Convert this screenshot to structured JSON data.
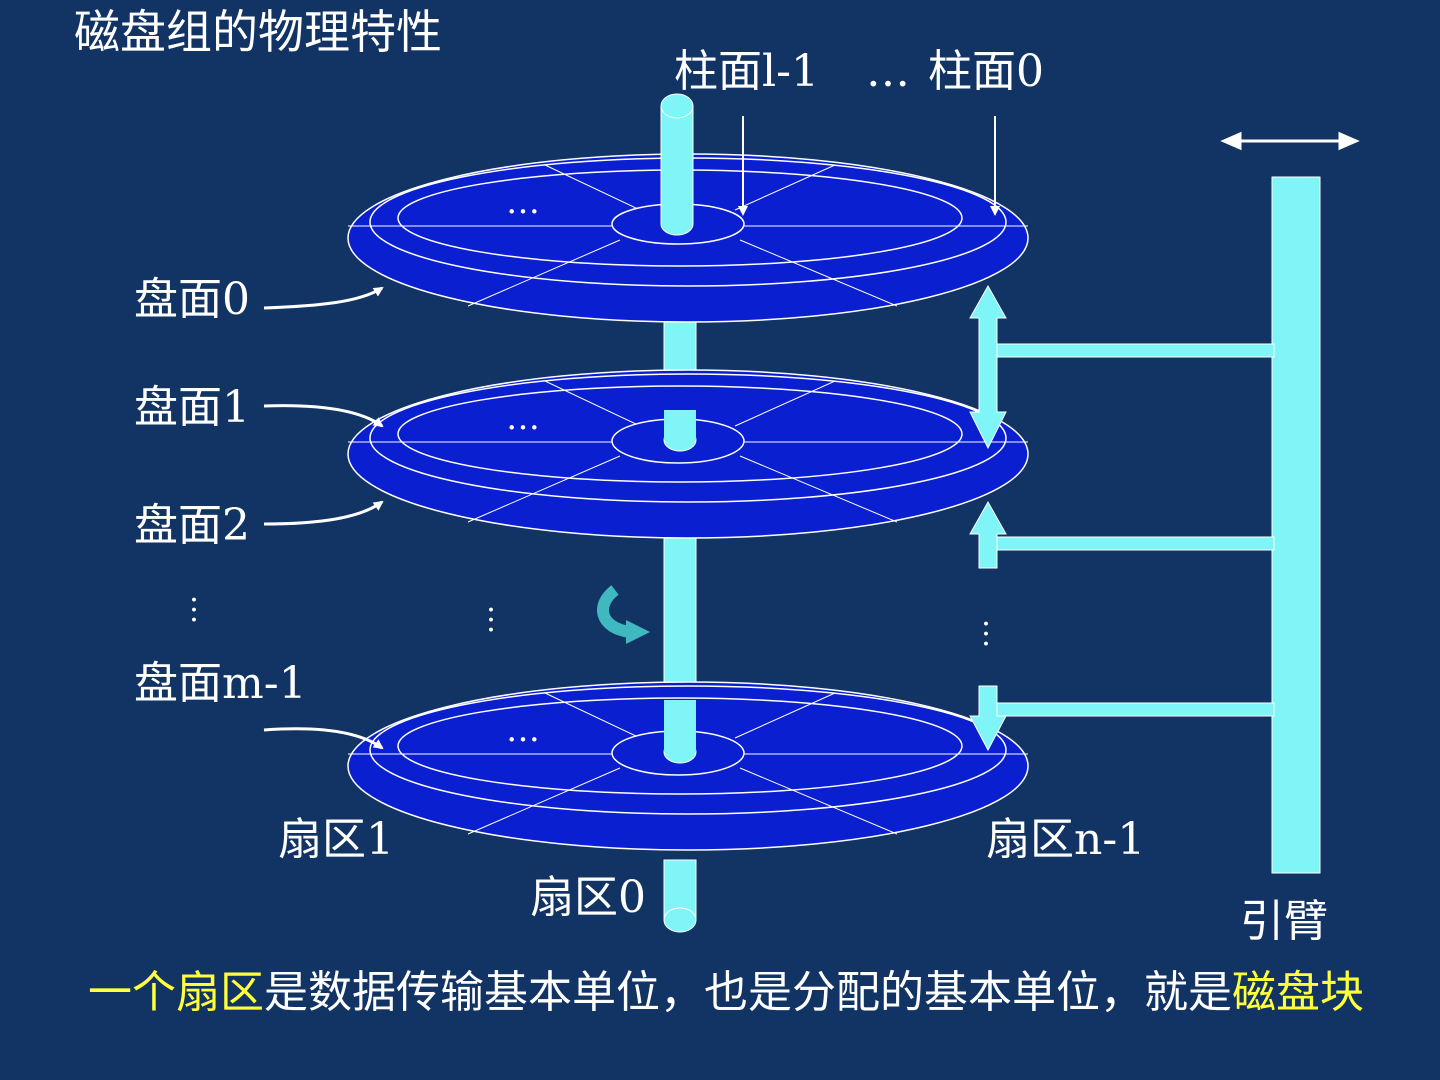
{
  "title": "磁盘组的物理特性",
  "labels": {
    "cylinder_l1": "柱面l-1",
    "ellipsis": "…",
    "cylinder_0": "柱面0",
    "surface_0": "盘面0",
    "surface_1": "盘面1",
    "surface_2": "盘面2",
    "surface_m1": "盘面m-1",
    "sector_1": "扇区1",
    "sector_n1": "扇区n-1",
    "sector_0": "扇区0",
    "arm": "引臂",
    "platter_dots": "…"
  },
  "footer": {
    "part1": "一个扇区",
    "part2": "是数据传输基本单位，也是分配的基本单位，就是",
    "part3": "磁盘块"
  },
  "colors": {
    "background": "#123464",
    "platter": "#0a1fd0",
    "spindle": "#7ff5f8",
    "highlight": "#ffff3c",
    "text": "#ffffff"
  }
}
